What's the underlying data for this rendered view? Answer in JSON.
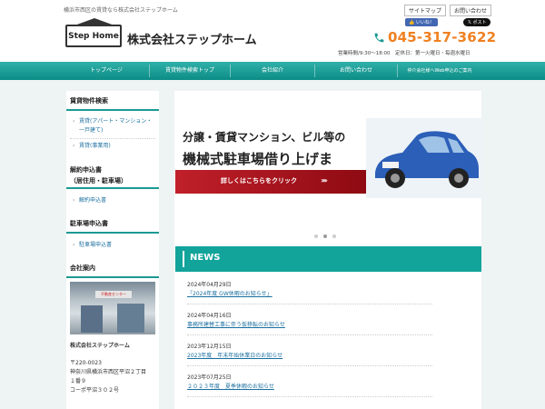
{
  "header": {
    "tagline": "横浜市西区の賃貸なら株式会社ステップホーム",
    "top_links": [
      "サイトマップ",
      "お問い合わせ"
    ],
    "logo_text": "Step Home",
    "company_name": "株式会社ステップホーム",
    "like_label": "いいね！",
    "post_label": "ポスト",
    "phone": "045-317-3622",
    "hours": "営業時間/9:30～18:00　定休日：第一火曜日・毎週水曜日",
    "accent_color": "#f08020"
  },
  "nav": {
    "items": [
      "トップページ",
      "賃貸物件検索トップ",
      "会社紹介",
      "お問い合わせ",
      "仲介会社様へWeb申込のご案内"
    ],
    "color": "#12a39b"
  },
  "sidebar": {
    "sections": [
      {
        "heading": "賃貸物件検索",
        "links": [
          "賃貸(アパート・マンション・一戸建て)",
          "賃貸(事業用)"
        ]
      },
      {
        "heading": "解約申込書\n（居住用・駐車場）",
        "links": [
          "解約申込書"
        ]
      },
      {
        "heading": "駐車場申込書",
        "links": [
          "駐車場申込書"
        ]
      },
      {
        "heading": "会社案内",
        "links": []
      }
    ],
    "photo_sign": "不動産センター",
    "info": {
      "name": "株式会社ステップホーム",
      "postal": "〒220-0023",
      "address1": "神奈川県横浜市西区平沼２丁目",
      "address2": "１番９",
      "address3": "コーポ平沼３０２号"
    }
  },
  "banner": {
    "line1": "分譲・賃貸マンション、ビル等の",
    "line2": "機械式駐車場借り上げます！！",
    "cta": "詳しくはこちらをクリック",
    "cta_color": "#c0202a",
    "slides_total": 3,
    "slide_active": 2
  },
  "news": {
    "title": "NEWS",
    "items": [
      {
        "date": "2024年04月29日",
        "text": "「2024年度 GW休暇のお知らせ」"
      },
      {
        "date": "2024年04月16日",
        "text": "事務所建替工事に伴う仮移転のお知らせ"
      },
      {
        "date": "2023年12月15日",
        "text": "2023年度　年末年始休業日のお知らせ"
      },
      {
        "date": "2023年07月25日",
        "text": "２０２３年度　夏季休暇のお知らせ"
      }
    ]
  }
}
